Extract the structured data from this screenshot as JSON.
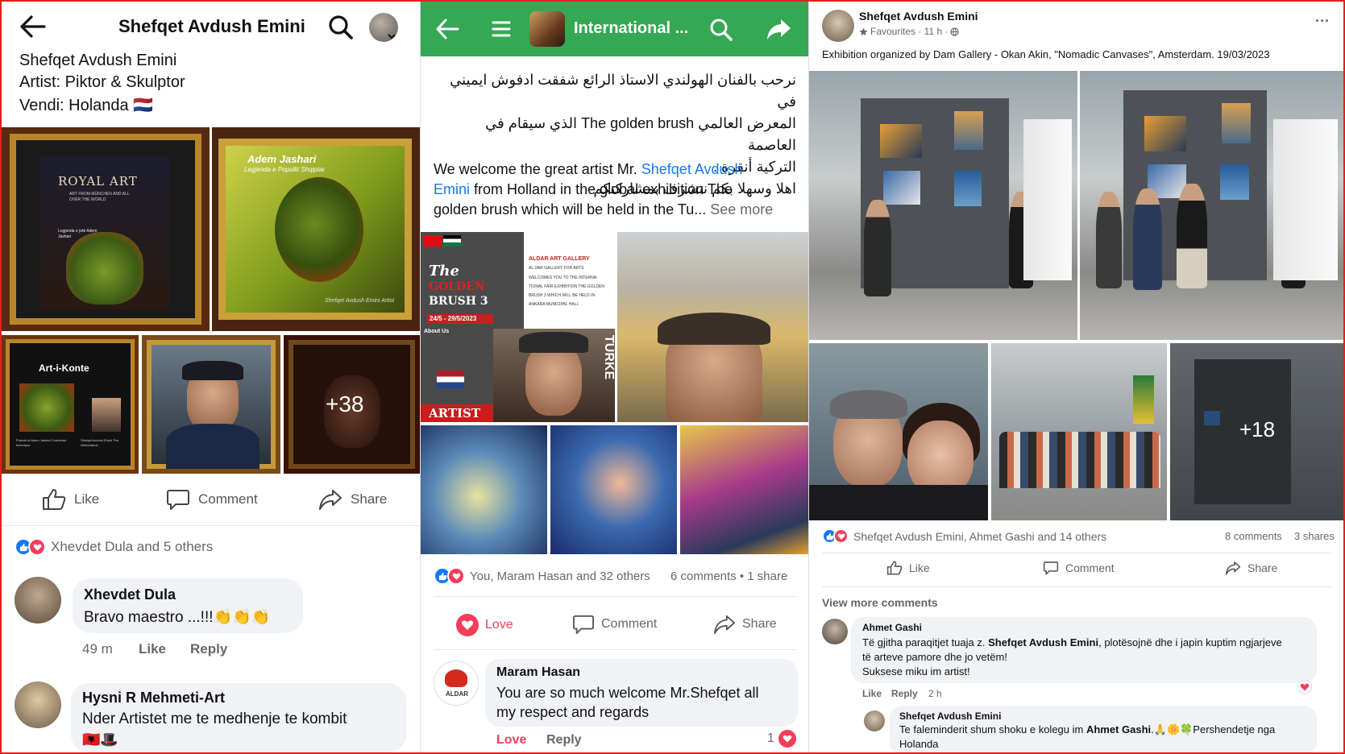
{
  "panel1": {
    "header_title": "Shefqet Avdush Emini",
    "intro_lines": [
      "Shefqet Avdush Emini",
      "Artist: Piktor & Skulptor",
      "Vendi: Holanda"
    ],
    "flag_nl": "🇳🇱",
    "poster1": {
      "brand": "ROYAL ART",
      "sub": "ART FROM MÜNCHEN AND ALL OVER THE WORLD",
      "mid": "Legjenda e jetë Adem Jashari"
    },
    "poster2": {
      "title": "Adem Jashari",
      "subtitle": "Legjenda e Popullit Shqiptar",
      "sign": "Shefqet Avdush Emini Artist"
    },
    "poster3": {
      "brand": "Art-i-Konte",
      "caption_left": "Portrait of Adem Jashari Combined technique",
      "caption_right": "Shefqet Avdush Emini The Netherlands"
    },
    "more_count": "+38",
    "actions": {
      "like": "Like",
      "comment": "Comment",
      "share": "Share"
    },
    "reactions_text": "Xhevdet Dula and 5 others",
    "comments": [
      {
        "author": "Xhevdet Dula",
        "text": "Bravo maestro ...!!!👏👏👏",
        "time": "49 m",
        "like": "Like",
        "reply": "Reply"
      },
      {
        "author": "Hysni R Mehmeti-Art",
        "text": "Nder Artistet me te medhenje te kombit",
        "emoji": "🇦🇱🎩"
      }
    ]
  },
  "panel2": {
    "header_title": "International ...",
    "arabic_lines": [
      "نرحب بالفنان الهولندي الاستاذ الرائع شفقت ادفوش ايميني  في",
      "المعرض العالمي  The golden brush  الذي سيقام في العاصمة",
      "التركية أنقرة  .",
      "اهلا وسهلا بكم نتشرف بمشاركتكم"
    ],
    "english_pre": "We welcome the great  artist Mr. ",
    "english_link": "Shefqet Avdush",
    "english_link2": "Emini",
    "english_post1": "  from Holland   in the global exhibition The",
    "english_post2": "golden brush which will be held in the Tu... ",
    "see_more": "See more",
    "poster": {
      "title1": "The",
      "title2": "GOLDEN",
      "title3": "BRUSH 3",
      "dates": "24/5 - 29/5/2023",
      "about": "About Us",
      "gallery": "ALDAR ART GALLERY",
      "gallery_sub": "AL DAR GALLERY FOR ARTS",
      "welcome": "WELCOMES YOU TO THE INTERNA- TIONAL FAIR EXHIBITION THE GOLDEN BRUSH 3 WHICH WILL BE HELD IN ANKARA MUNICIPAL HALL",
      "vertical": "TURKE",
      "artist": "ARTIST"
    },
    "reactions_text": "You, Maram Hasan and 32 others",
    "counts": "6 comments • 1 share",
    "actions": {
      "love": "Love",
      "comment": "Comment",
      "share": "Share"
    },
    "comment": {
      "author": "Maram Hasan",
      "text1": "You are so much welcome Mr.Shefqet all",
      "text2": "my respect and regards",
      "love": "Love",
      "reply": "Reply",
      "count": "1",
      "avatar_label": "ALDAR"
    }
  },
  "panel3": {
    "author": "Shefqet Avdush Emini",
    "meta": "Favourites · 11 h ·",
    "more": "···",
    "caption": "Exhibition organized by Dam Gallery - Okan Akin, \"Nomadic  Canvases\", Amsterdam. 19/03/2023",
    "more_count": "+18",
    "reactions_text": "Shefqet Avdush Emini, Ahmet Gashi and 14 others",
    "comments_count": "8 comments",
    "shares_count": "3 shares",
    "actions": {
      "like": "Like",
      "comment": "Comment",
      "share": "Share"
    },
    "view_more": "View more comments",
    "comments": [
      {
        "author": "Ahmet Gashi",
        "line1_pre": "Të gjitha paraqitjet tuaja z. ",
        "line1_bold": "Shefqet Avdush Emini",
        "line1_post": ", plotësojnë dhe i japin kuptim ngjarjeve",
        "line2": "të arteve pamore dhe jo vetëm!",
        "line3": "Suksese miku im artist!",
        "like": "Like",
        "reply": "Reply",
        "time": "2 h"
      },
      {
        "author": "Shefqet Avdush Emini",
        "line1_pre": "Te faleminderit shum shoku e kolegu im ",
        "line1_bold": "Ahmet Gashi",
        "line1_post": ".🙏🌼🍀Pershendetje nga",
        "line2": "Holanda"
      }
    ]
  },
  "colors": {
    "fb_blue": "#1877f2",
    "fb_green": "#34a853",
    "love_red": "#f33e58",
    "frame_red": "#e02020"
  }
}
